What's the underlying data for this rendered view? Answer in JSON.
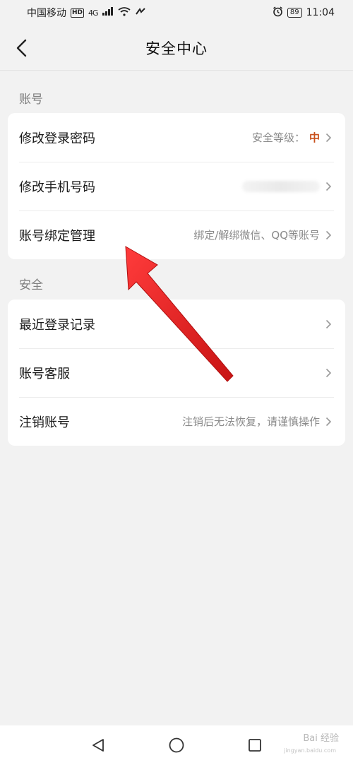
{
  "status_bar": {
    "carrier": "中国移动",
    "hd": "HD",
    "network": "4G",
    "battery": "89",
    "time": "11:04"
  },
  "nav": {
    "title": "安全中心"
  },
  "sections": {
    "account": {
      "label": "账号",
      "items": [
        {
          "label": "修改登录密码",
          "value_prefix": "安全等级：",
          "value_level": "中"
        },
        {
          "label": "修改手机号码",
          "value": ""
        },
        {
          "label": "账号绑定管理",
          "value": "绑定/解绑微信、QQ等账号"
        }
      ]
    },
    "security": {
      "label": "安全",
      "items": [
        {
          "label": "最近登录记录",
          "value": ""
        },
        {
          "label": "账号客服",
          "value": ""
        },
        {
          "label": "注销账号",
          "value": "注销后无法恢复，请谨慎操作"
        }
      ]
    }
  },
  "colors": {
    "accent_level": "#c8501c",
    "annotation_arrow": "#e32a2a"
  },
  "watermark": {
    "text": "Bai 经验",
    "sub": "jingyan.baidu.com"
  }
}
